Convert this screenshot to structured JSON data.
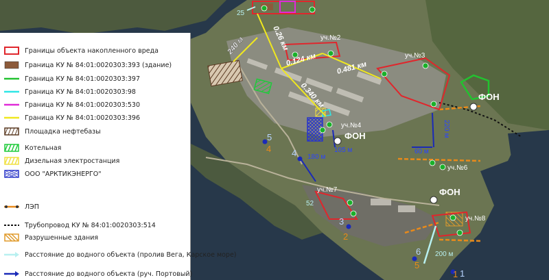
{
  "legend": {
    "items": [
      {
        "label": "Границы объекта накопленного вреда",
        "symbol": "box-outline",
        "color": "#e0262c"
      },
      {
        "label": "Граница КУ № 84:01:0020303:393 (здание)",
        "symbol": "box-fill",
        "color": "#8c5a3a"
      },
      {
        "label": "Граница КУ № 84:01:0020303:397",
        "symbol": "line",
        "color": "#22c230"
      },
      {
        "label": "Граница КУ № 84:01:0020303:98",
        "symbol": "line",
        "color": "#2ee6e6"
      },
      {
        "label": "Граница КУ № 84:01:0020303:530",
        "symbol": "line",
        "color": "#e02ad8"
      },
      {
        "label": "Граница КУ № 84:01:0020303:396",
        "symbol": "line",
        "color": "#f0e81e"
      },
      {
        "label": "Площадка нефтебазы",
        "symbol": "hatch-box",
        "color": "#5a3a22"
      },
      {
        "label": "Котельная",
        "symbol": "green-hatch",
        "color": "#1ecb3a"
      },
      {
        "label": "Дизельная электростанция",
        "symbol": "yellow-hatch",
        "color": "#f0e040"
      },
      {
        "label": "ООО \"АРКТИКЭНЕРГО\"",
        "symbol": "blue-hatch",
        "color": "#2a36c8"
      },
      {
        "label": "ЛЭП",
        "symbol": "power-line",
        "color": "#e98a1a"
      },
      {
        "label": "Трубопровод КУ № 84:01:0020303:514",
        "symbol": "dotted",
        "color": "#111111"
      },
      {
        "label": "Разрушенные здания",
        "symbol": "orange-hatch",
        "color": "#e09a2a"
      },
      {
        "label": "Расстояние до водного объекта (пролив Вега, Карское море)",
        "symbol": "arrow",
        "color": "#b8f0f0"
      },
      {
        "label": "Расстояние до водного объекта (руч. Портовый)",
        "symbol": "arrow",
        "color": "#1a2ab8"
      }
    ]
  },
  "map": {
    "sites": [
      {
        "label": "уч.№2"
      },
      {
        "label": "уч.№3"
      },
      {
        "label": "уч.№4"
      },
      {
        "label": "уч.№6"
      },
      {
        "label": "уч.№7"
      },
      {
        "label": "уч.№8"
      }
    ],
    "background_points": [
      "ФОН",
      "ФОН",
      "ФОН",
      "ФОН"
    ],
    "distances": {
      "d_240": "240 м",
      "d_026": "0.26 км",
      "d_0124": "0.124 км",
      "d_0481": "0.481 км",
      "d_0340": "0.340 км",
      "d_220": "220 м",
      "d_60": "60 м",
      "d_105": "105 м",
      "d_180": "180 м",
      "d_52": "52",
      "d_200": "200 м",
      "d_25": "25"
    },
    "water_points": [
      "1",
      "2",
      "3",
      "4",
      "5",
      "6"
    ],
    "colors": {
      "boundary": "#e0262c",
      "distance_line": "#f0e81e",
      "water_dist_blue": "#1a2ab8",
      "water_dist_cyan": "#b8f0f0"
    }
  }
}
